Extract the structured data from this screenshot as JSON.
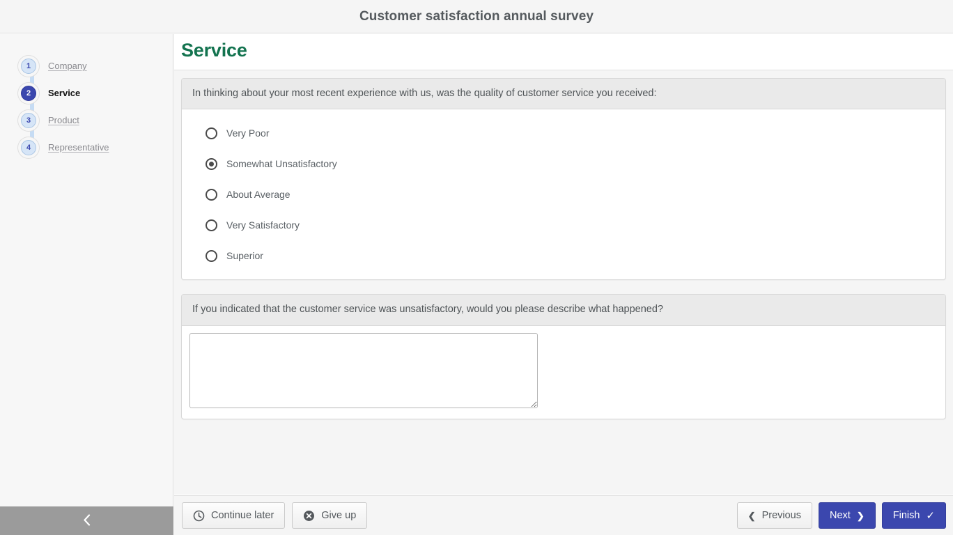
{
  "header": {
    "title": "Customer satisfaction annual survey"
  },
  "sidebar": {
    "steps": [
      {
        "number": "1",
        "label": "Company",
        "active": false
      },
      {
        "number": "2",
        "label": "Service",
        "active": true
      },
      {
        "number": "3",
        "label": "Product",
        "active": false
      },
      {
        "number": "4",
        "label": "Representative",
        "active": false
      }
    ],
    "collapse_icon": "chevron-left-icon",
    "collapse_glyph": "‹"
  },
  "main": {
    "page_title": "Service",
    "title_color": "#13734f",
    "accent_color": "#3b47ae",
    "questions": [
      {
        "id": "service-quality",
        "prompt": "In thinking about your most recent experience with us, was the quality of customer service you received:",
        "type": "radio",
        "options": [
          {
            "label": "Very Poor",
            "selected": false
          },
          {
            "label": "Somewhat Unsatisfactory",
            "selected": true
          },
          {
            "label": "About Average",
            "selected": false
          },
          {
            "label": "Very Satisfactory",
            "selected": false
          },
          {
            "label": "Superior",
            "selected": false
          }
        ]
      },
      {
        "id": "service-description",
        "prompt": "If you indicated that the customer service was unsatisfactory, would you please describe what happened?",
        "type": "textarea",
        "value": "",
        "placeholder": ""
      }
    ]
  },
  "footer": {
    "continue_later": {
      "label": "Continue later",
      "icon": "clock-icon"
    },
    "give_up": {
      "label": "Give up",
      "icon": "circle-x-icon"
    },
    "previous": {
      "label": "Previous",
      "icon": "chevron-left-icon",
      "glyph": "❮"
    },
    "next": {
      "label": "Next",
      "icon": "chevron-right-icon",
      "glyph": "❯"
    },
    "finish": {
      "label": "Finish",
      "icon": "check-icon",
      "glyph": "✓"
    }
  }
}
